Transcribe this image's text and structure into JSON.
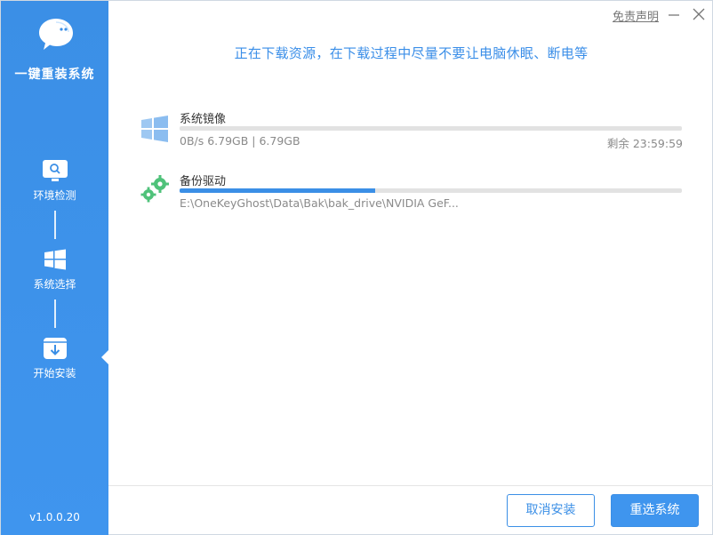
{
  "app": {
    "title": "一键重装系统",
    "version": "v1.0.0.20"
  },
  "titlebar": {
    "disclaimer": "免责声明",
    "minimize_icon": "minimize-icon",
    "close_icon": "close-icon"
  },
  "steps": [
    {
      "label": "环境检测",
      "icon": "monitor-search-icon"
    },
    {
      "label": "系统选择",
      "icon": "windows-icon"
    },
    {
      "label": "开始安装",
      "icon": "download-box-icon",
      "active": true
    }
  ],
  "main": {
    "headline": "正在下载资源，在下载过程中尽量不要让电脑休眠、断电等",
    "tasks": [
      {
        "name": "系统镜像",
        "icon": "windows-icon",
        "progress": 1.0,
        "progress_color": "#e2e2e2",
        "size_text": "0B/s 6.79GB | 6.79GB",
        "remaining": "剩余 23:59:59"
      },
      {
        "name": "备份驱动",
        "icon": "gears-icon",
        "progress": 0.39,
        "progress_color": "#3b8fe6",
        "size_text": "E:\\OneKeyGhost\\Data\\Bak\\bak_drive\\NVIDIA GeF...",
        "remaining": ""
      }
    ]
  },
  "footer": {
    "cancel_label": "取消安装",
    "reselect_label": "重选系统"
  },
  "colors": {
    "accent": "#3b8fe6",
    "sidebar": "#3f95ee",
    "gear": "#4fc27a"
  }
}
